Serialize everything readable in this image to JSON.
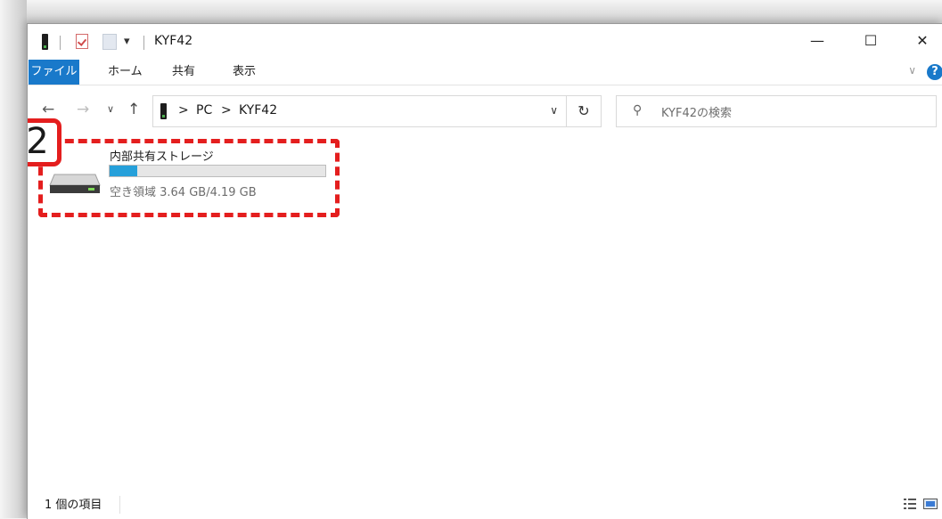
{
  "window": {
    "title": "KYF42",
    "qa_dropdown": "▾",
    "controls": {
      "minimize": "—",
      "maximize": "☐",
      "close": "✕"
    }
  },
  "ribbon": {
    "tabs": [
      "ファイル",
      "ホーム",
      "共有",
      "表示"
    ],
    "caret": "∨",
    "help": "?"
  },
  "nav": {
    "back": "←",
    "forward": "→",
    "recent": "∨",
    "up": "↑",
    "breadcrumb": [
      "PC",
      "KYF42"
    ],
    "breadcrumb_sep": ">",
    "address_dropdown": "∨",
    "refresh": "↻"
  },
  "search": {
    "placeholder": "KYF42の検索",
    "icon": "search-icon"
  },
  "callout": {
    "step": "2",
    "color": "#e41e1e"
  },
  "storage": {
    "name": "内部共有ストレージ",
    "free_label": "空き領域 3.64 GB/4.19 GB",
    "used_fraction": 0.13,
    "bar_color": "#26a0da"
  },
  "status": {
    "item_count": "1 個の項目"
  },
  "colors": {
    "accent": "#1979ca"
  }
}
